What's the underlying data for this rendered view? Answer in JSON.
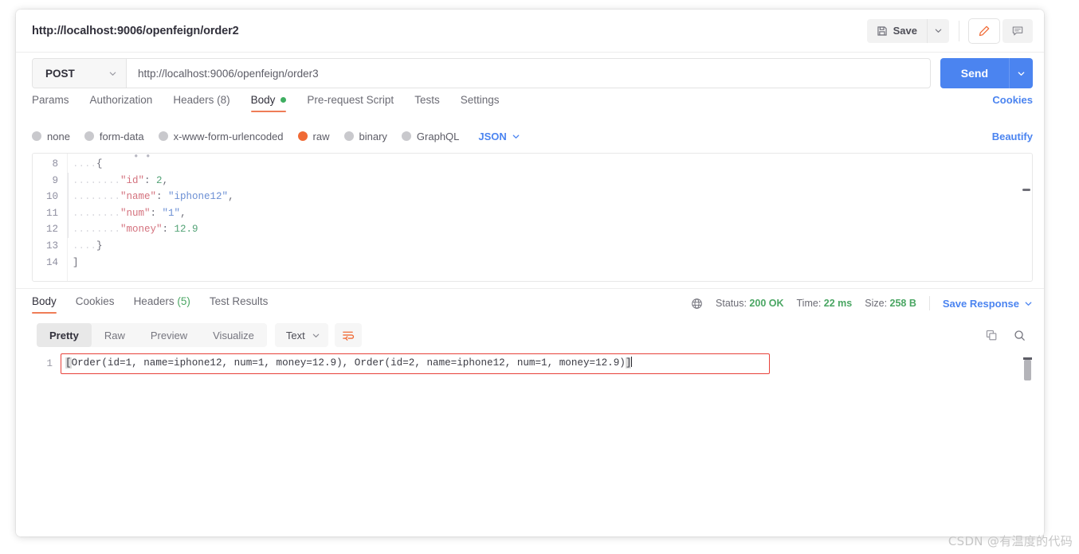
{
  "window": {
    "request_title": "http://localhost:9006/openfeign/order2"
  },
  "toolbar": {
    "save_label": "Save",
    "save_icon": "floppy-disk-icon",
    "save_caret_icon": "chevron-down-icon",
    "edit_icon": "pencil-icon",
    "comment_icon": "comment-icon",
    "accent_orange": "#f06a35"
  },
  "url_bar": {
    "method": "POST",
    "method_caret_icon": "chevron-down-icon",
    "url_value": "http://localhost:9006/openfeign/order3",
    "url_placeholder": "Enter request URL",
    "send_label": "Send",
    "send_caret_icon": "chevron-down-icon",
    "send_color": "#4b84f0"
  },
  "request_tabs": {
    "items": [
      {
        "label": "Params",
        "active": false
      },
      {
        "label": "Authorization",
        "active": false
      },
      {
        "label": "Headers (8)",
        "active": false
      },
      {
        "label": "Body",
        "active": true,
        "dot": true
      },
      {
        "label": "Pre-request Script",
        "active": false
      },
      {
        "label": "Tests",
        "active": false
      },
      {
        "label": "Settings",
        "active": false
      }
    ],
    "cookies_link": "Cookies"
  },
  "body_types": {
    "options": [
      {
        "label": "none",
        "selected": false
      },
      {
        "label": "form-data",
        "selected": false
      },
      {
        "label": "x-www-form-urlencoded",
        "selected": false
      },
      {
        "label": "raw",
        "selected": true
      },
      {
        "label": "binary",
        "selected": false
      },
      {
        "label": "GraphQL",
        "selected": false
      }
    ],
    "format": "JSON",
    "format_caret_icon": "chevron-down-icon",
    "beautify_link": "Beautify"
  },
  "editor": {
    "line_numbers": [
      "8",
      "9",
      "10",
      "11",
      "12",
      "13",
      "14"
    ],
    "lines": [
      {
        "indent": "....",
        "tokens": [
          {
            "t": "{",
            "c": "brace"
          }
        ]
      },
      {
        "indent": "........",
        "tokens": [
          {
            "t": "\"id\"",
            "c": "k"
          },
          {
            "t": ":",
            "c": "p"
          },
          {
            "t": " 2",
            "c": "n"
          },
          {
            "t": ",",
            "c": "p"
          }
        ]
      },
      {
        "indent": "........",
        "tokens": [
          {
            "t": "\"name\"",
            "c": "k"
          },
          {
            "t": ":",
            "c": "p"
          },
          {
            "t": " \"iphone12\"",
            "c": "s"
          },
          {
            "t": ",",
            "c": "p"
          }
        ]
      },
      {
        "indent": "........",
        "tokens": [
          {
            "t": "\"num\"",
            "c": "k"
          },
          {
            "t": ":",
            "c": "p"
          },
          {
            "t": " \"1\"",
            "c": "s"
          },
          {
            "t": ",",
            "c": "p"
          }
        ]
      },
      {
        "indent": "........",
        "tokens": [
          {
            "t": "\"money\"",
            "c": "k"
          },
          {
            "t": ":",
            "c": "p"
          },
          {
            "t": " 12.9",
            "c": "n"
          }
        ]
      },
      {
        "indent": "....",
        "tokens": [
          {
            "t": "}",
            "c": "brace"
          }
        ]
      },
      {
        "indent": "",
        "tokens": [
          {
            "t": "]",
            "c": "brace"
          }
        ]
      }
    ]
  },
  "response_tabs": {
    "items": [
      {
        "label": "Body",
        "active": true
      },
      {
        "label": "Cookies",
        "active": false
      },
      {
        "label": "Headers (5)",
        "active": false,
        "count": "(5)"
      },
      {
        "label": "Test Results",
        "active": false
      }
    ]
  },
  "response_meta": {
    "globe_icon": "globe-icon",
    "status_label": "Status:",
    "status_value": "200 OK",
    "time_label": "Time:",
    "time_value": "22 ms",
    "size_label": "Size:",
    "size_value": "258 B",
    "save_response_label": "Save Response",
    "save_response_caret_icon": "chevron-down-icon"
  },
  "response_toolbar": {
    "views": [
      {
        "label": "Pretty",
        "active": true
      },
      {
        "label": "Raw",
        "active": false
      },
      {
        "label": "Preview",
        "active": false
      },
      {
        "label": "Visualize",
        "active": false
      }
    ],
    "format": "Text",
    "format_caret_icon": "chevron-down-icon",
    "wrap_icon": "word-wrap-icon",
    "copy_icon": "copy-icon",
    "search_icon": "search-icon"
  },
  "response_body": {
    "line_number": "1",
    "text_open": "[",
    "text_main": "Order(id=1, name=iphone12, num=1, money=12.9), Order(id=2, name=iphone12, num=1, money=12.9)",
    "text_close": "]",
    "highlight_color": "#e8413a"
  },
  "watermark": {
    "text": "CSDN @有温度的代码"
  }
}
